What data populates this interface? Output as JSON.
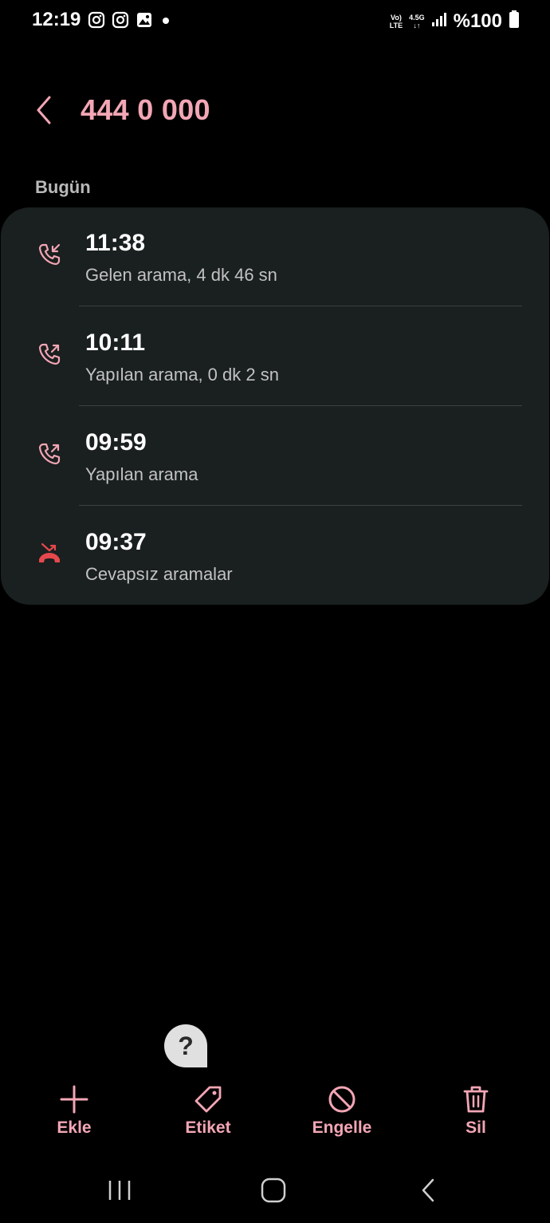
{
  "status_bar": {
    "time": "12:19",
    "network_top": "Vo)",
    "network_bottom": "LTE",
    "data_top": "4.5G",
    "data_bottom": "↓↑",
    "battery": "%100",
    "icons": [
      "instagram-icon",
      "instagram-icon",
      "gallery-icon",
      "dot-icon",
      "signal-icon",
      "battery-icon"
    ]
  },
  "header": {
    "title": "444 0 000",
    "back_icon": "chevron-left-icon"
  },
  "section": {
    "label": "Bugün"
  },
  "calls": [
    {
      "time": "11:38",
      "description": "Gelen arama, 4 dk 46 sn",
      "type": "incoming",
      "icon": "incoming-call-icon"
    },
    {
      "time": "10:11",
      "description": "Yapılan arama, 0 dk 2 sn",
      "type": "outgoing",
      "icon": "outgoing-call-icon"
    },
    {
      "time": "09:59",
      "description": "Yapılan arama",
      "type": "outgoing",
      "icon": "outgoing-call-icon"
    },
    {
      "time": "09:37",
      "description": "Cevapsız aramalar",
      "type": "missed",
      "icon": "missed-call-icon"
    }
  ],
  "help": {
    "label": "?"
  },
  "actions": [
    {
      "label": "Ekle",
      "icon": "plus-icon"
    },
    {
      "label": "Etiket",
      "icon": "tag-icon"
    },
    {
      "label": "Engelle",
      "icon": "block-icon"
    },
    {
      "label": "Sil",
      "icon": "trash-icon"
    }
  ],
  "nav": {
    "recents_icon": "recents-icon",
    "home_icon": "home-icon",
    "back_icon": "back-icon"
  },
  "colors": {
    "accent": "#f3a6b5",
    "missed": "#e5484d",
    "card_background": "#1a1f1f",
    "background": "#000000"
  }
}
